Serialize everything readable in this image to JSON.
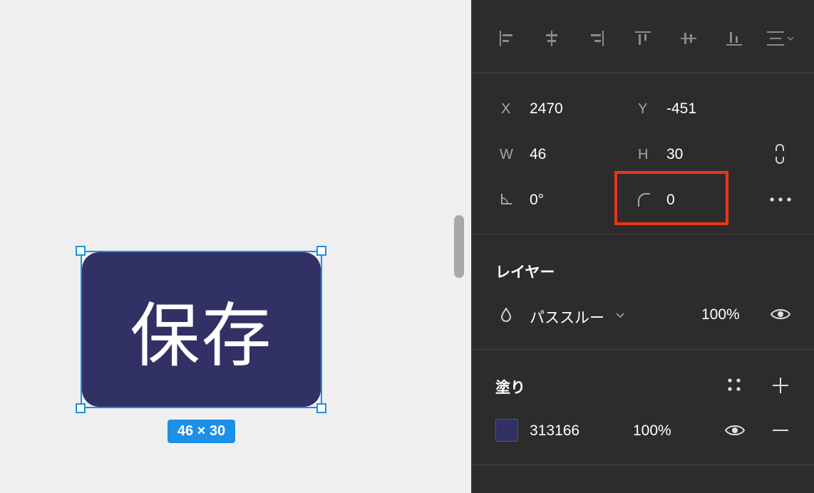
{
  "canvas": {
    "button_label": "保存",
    "size_badge": "46 × 30",
    "fill_color": "#313166",
    "selection_color": "#1c8fe8"
  },
  "panel": {
    "alignment_icons": [
      "align-left-icon",
      "align-horizontal-center-icon",
      "align-right-icon",
      "align-top-icon",
      "align-vertical-center-icon",
      "align-bottom-icon",
      "distribute-menu-icon"
    ],
    "position": {
      "x_label": "X",
      "x_value": "2470",
      "y_label": "Y",
      "y_value": "-451"
    },
    "size": {
      "w_label": "W",
      "w_value": "46",
      "h_label": "H",
      "h_value": "30"
    },
    "rotation_value": "0°",
    "corner_radius_value": "0",
    "layer": {
      "title": "レイヤー",
      "blend_mode": "パススルー",
      "opacity": "100%"
    },
    "fill": {
      "title": "塗り",
      "hex": "313166",
      "opacity": "100%",
      "swatch_color": "#313166"
    },
    "highlight_color": "#e8341c"
  }
}
